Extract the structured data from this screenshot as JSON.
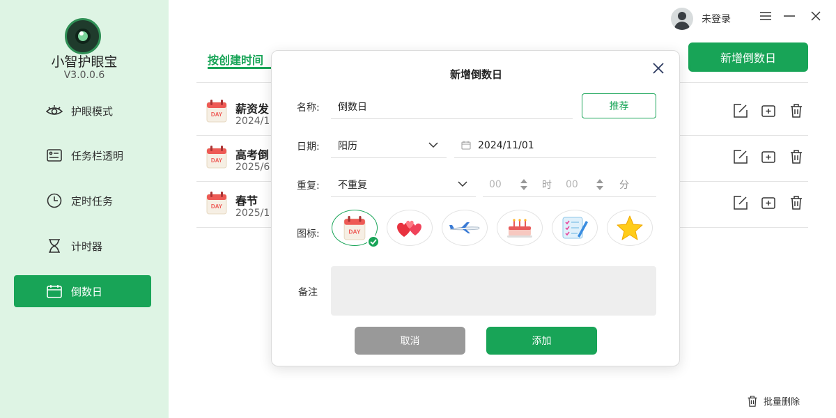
{
  "app": {
    "name": "小智护眼宝",
    "version": "V3.0.0.6"
  },
  "sidebar": {
    "items": [
      {
        "label": "护眼模式",
        "icon": "eye-icon",
        "active": false
      },
      {
        "label": "任务栏透明",
        "icon": "taskbar-icon",
        "active": false
      },
      {
        "label": "定时任务",
        "icon": "clock-icon",
        "active": false
      },
      {
        "label": "计时器",
        "icon": "hourglass-icon",
        "active": false
      },
      {
        "label": "倒数日",
        "icon": "calendar-icon",
        "active": true
      }
    ]
  },
  "topbar": {
    "user_label": "未登录"
  },
  "main": {
    "tab_label": "按创建时间",
    "new_button": "新增倒数日",
    "rows": [
      {
        "name": "薪资发",
        "date": "2024/1"
      },
      {
        "name": "高考倒",
        "date": "2025/6"
      },
      {
        "name": "春节",
        "date": "2025/1"
      }
    ],
    "batch_delete": "批量删除"
  },
  "modal": {
    "title": "新增倒数日",
    "name_label": "名称:",
    "name_value": "倒数日",
    "recommend_button": "推荐",
    "date_label": "日期:",
    "calendar_type": "阳历",
    "date_value": "2024/11/01",
    "repeat_label": "重复:",
    "repeat_value": "不重复",
    "hour_value": "00",
    "hour_unit": "时",
    "minute_value": "00",
    "minute_unit": "分",
    "icon_label": "图标:",
    "icon_options": [
      "calendar-day-icon",
      "hearts-icon",
      "airplane-icon",
      "cake-icon",
      "checklist-icon",
      "star-icon"
    ],
    "day_badge": "DAY",
    "remark_label": "备注",
    "remark_value": "",
    "cancel_button": "取消",
    "add_button": "添加"
  },
  "colors": {
    "accent": "#18a457",
    "sidebar_bg": "#def4e4",
    "cancel_grey": "#999999"
  }
}
